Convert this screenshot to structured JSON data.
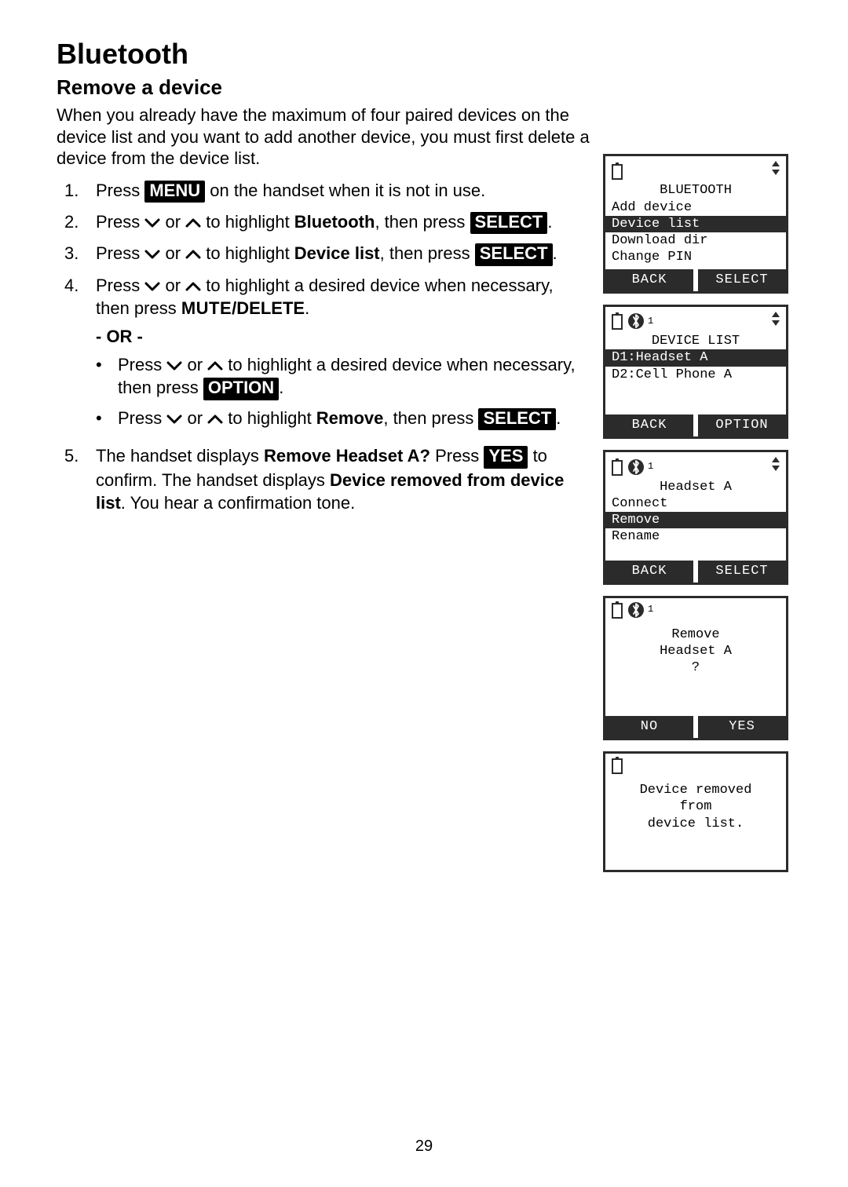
{
  "page_number": "29",
  "title": "Bluetooth",
  "subtitle": "Remove a device",
  "intro": "When you already have the maximum of four paired devices on the device list and you want to add another device, you must first delete a device from the device list.",
  "labels": {
    "menu": "MENU",
    "select": "SELECT",
    "option": "OPTION",
    "yes": "YES",
    "mute_delete_pre": "MUTE",
    "mute_delete_post": "/DELETE",
    "or": "- OR -"
  },
  "steps": {
    "s1_a": "Press ",
    "s1_b": " on the handset when it is not in use.",
    "s2_a": "Press ",
    "s2_mid": " or ",
    "s2_b": " to highlight ",
    "s2_bold": "Bluetooth",
    "s2_c": ", then press ",
    "s3_b": " to highlight ",
    "s3_bold": "Device list",
    "s3_c": ", then press ",
    "s4_b": " to highlight a desired device when necessary, then press ",
    "s4o_b": " to highlight a desired device when necessary, then press ",
    "s4r_b": " to highlight ",
    "s4r_bold": "Remove",
    "s4r_c": ", then press ",
    "s5_a": "The handset displays ",
    "s5_bold1": "Remove Headset A?",
    "s5_b": " Press ",
    "s5_c": " to confirm. The handset displays ",
    "s5_bold2": "Device removed from device list",
    "s5_d": ". You hear a confirmation tone."
  },
  "screens": [
    {
      "id": "bt-menu",
      "has_bt_icon": false,
      "has_updown": true,
      "title": "BLUETOOTH",
      "rows": [
        {
          "text": "Add device",
          "sel": false
        },
        {
          "text": "Device list",
          "sel": true
        },
        {
          "text": "Download dir",
          "sel": false
        },
        {
          "text": "Change PIN",
          "sel": false
        }
      ],
      "soft_left": "BACK",
      "soft_right": "SELECT"
    },
    {
      "id": "device-list",
      "has_bt_icon": true,
      "has_updown": true,
      "title": "DEVICE LIST",
      "rows": [
        {
          "text": "D1:Headset A",
          "sel": true
        },
        {
          "text": "D2:Cell Phone A",
          "sel": false
        }
      ],
      "soft_left": "BACK",
      "soft_right": "OPTION"
    },
    {
      "id": "headset-options",
      "has_bt_icon": true,
      "has_updown": true,
      "title": "Headset A",
      "rows": [
        {
          "text": "Connect",
          "sel": false
        },
        {
          "text": "Remove",
          "sel": true
        },
        {
          "text": "Rename",
          "sel": false
        }
      ],
      "soft_left": "BACK",
      "soft_right": "SELECT"
    },
    {
      "id": "remove-confirm",
      "has_bt_icon": true,
      "has_updown": false,
      "center_block": [
        "Remove",
        "Headset A",
        "?"
      ],
      "soft_left": "NO",
      "soft_right": "YES"
    },
    {
      "id": "removed-msg",
      "has_bt_icon": false,
      "has_updown": false,
      "center_block": [
        "Device removed",
        "from",
        "device list."
      ]
    }
  ]
}
